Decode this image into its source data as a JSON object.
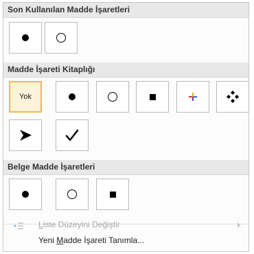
{
  "sections": {
    "recent": "Son Kullanılan Madde İşaretleri",
    "library": "Madde İşareti Kitaplığı",
    "document": "Belge Madde İşaretleri"
  },
  "library": {
    "none_label": "Yok"
  },
  "menu": {
    "change_level": {
      "mnemonic": "L",
      "rest": "iste Düzeyini Değiştir"
    },
    "define_new": {
      "before": "Yeni ",
      "mnemonic": "M",
      "after": "adde İşareti Tanımla..."
    }
  },
  "icons": {
    "dot": "bullet-dot-icon",
    "circle": "bullet-circle-icon",
    "square": "bullet-square-icon",
    "cross": "bullet-colored-cross-icon",
    "diamonds": "bullet-four-diamonds-icon",
    "arrowhead": "bullet-arrowhead-icon",
    "check": "bullet-checkmark-icon",
    "indent": "list-level-icon"
  },
  "colors": {
    "selected_border": "#f0b84a",
    "selected_fill": "#fdf3dc",
    "section_header": "#e8e8e8",
    "disabled_text": "#a6a6a6"
  }
}
